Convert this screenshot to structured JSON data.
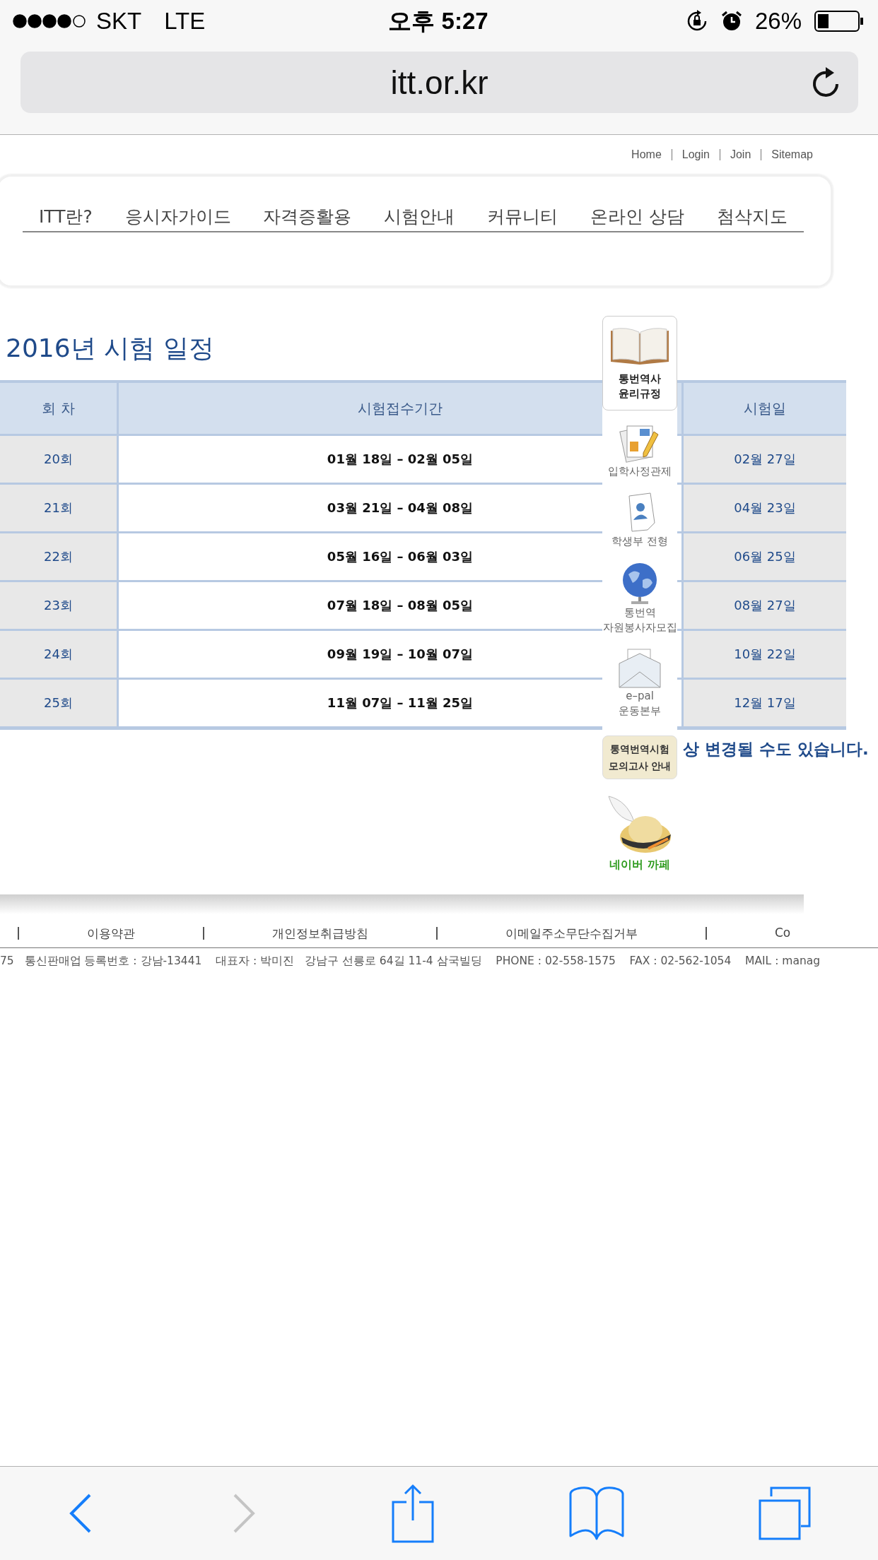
{
  "status_bar": {
    "carrier": "SKT",
    "network": "LTE",
    "time": "오후 5:27",
    "battery": "26%"
  },
  "url_bar": {
    "url": "itt.or.kr"
  },
  "top_links": [
    "Home",
    "Login",
    "Join",
    "Sitemap"
  ],
  "nav": [
    "ITT란?",
    "응시자가이드",
    "자격증활용",
    "시험안내",
    "커뮤니티",
    "온라인 상담",
    "첨삭지도"
  ],
  "title": "2016년 시험 일정",
  "table": {
    "columns": [
      "회 차",
      "시험접수기간",
      "시험일"
    ],
    "rows": [
      [
        "20회",
        "01월 18일 – 02월 05일",
        "02월 27일"
      ],
      [
        "21회",
        "03월 21일 – 04월 08일",
        "04월 23일"
      ],
      [
        "22회",
        "05월 16일 – 06월 03일",
        "06월 25일"
      ],
      [
        "23회",
        "07월 18일 – 08월 05일",
        "08월 27일"
      ],
      [
        "24회",
        "09월 19일 – 10월 07일",
        "10월 22일"
      ],
      [
        "25회",
        "11월 07일 – 11월 25일",
        "12월 17일"
      ]
    ]
  },
  "notice": "상 변경될 수도 있습니다.",
  "quick_menu": [
    {
      "kind": "card",
      "lines": [
        "통번역사",
        "윤리규정"
      ]
    },
    {
      "kind": "icon",
      "lines": [
        "입학사정관제"
      ]
    },
    {
      "kind": "icon",
      "lines": [
        "학생부 전형"
      ]
    },
    {
      "kind": "icon",
      "lines": [
        "통번역",
        "자원봉사자모집"
      ]
    },
    {
      "kind": "icon",
      "lines": [
        "e–pal",
        "운동본부"
      ]
    },
    {
      "kind": "button",
      "lines": [
        "통역번역시험",
        "모의고사 안내"
      ]
    },
    {
      "kind": "cafe",
      "lines": [
        "네이버 까페"
      ]
    }
  ],
  "footer_links": [
    "이용약관",
    "개인정보취급방침",
    "이메일주소무단수집거부",
    "Co"
  ],
  "footer_info": "75   통신판매업 등록번호 : 강남-13441    대표자 : 박미진   강남구 선릉로 64길 11-4 삼국빌딩    PHONE : 02-558-1575    FAX : 02-562-1054    MAIL : manag"
}
